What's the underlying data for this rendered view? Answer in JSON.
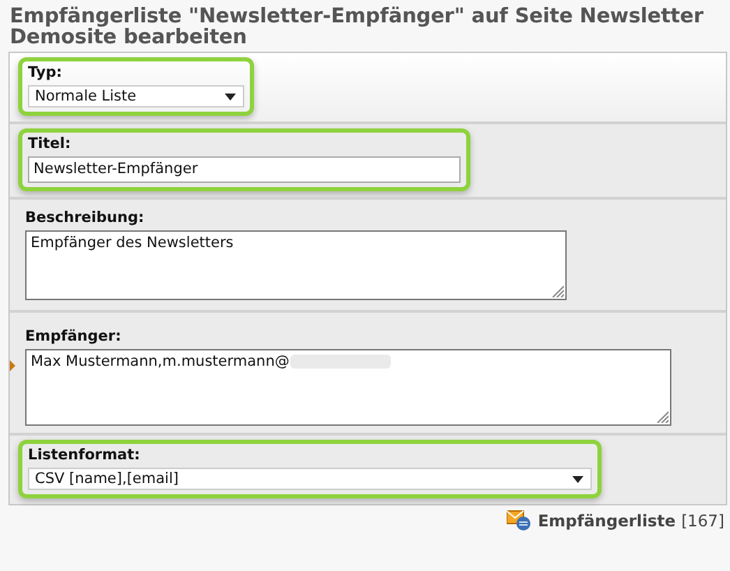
{
  "page_title": "Empfängerliste \"Newsletter-Empfänger\" auf Seite Newsletter Demosite bearbeiten",
  "fields": [
    {
      "kind": "select",
      "label": "Typ:",
      "value": "Normale Liste",
      "highlighted": true,
      "flagged": false
    },
    {
      "kind": "input",
      "label": "Titel:",
      "value": "Newsletter-Empfänger",
      "highlighted": true,
      "flagged": false
    },
    {
      "kind": "textarea",
      "label": "Beschreibung:",
      "value": "Empfänger des Newsletters",
      "highlighted": false,
      "flagged": false
    },
    {
      "kind": "textarea",
      "label": "Empfänger:",
      "value": "Max Mustermann,m.mustermann@",
      "redacted": true,
      "highlighted": false,
      "flagged": true
    },
    {
      "kind": "select",
      "label": "Listenformat:",
      "value": "CSV [name],[email]",
      "highlighted": true,
      "flagged": false
    }
  ],
  "footer": {
    "label": "Empfängerliste",
    "count": "[167]"
  }
}
